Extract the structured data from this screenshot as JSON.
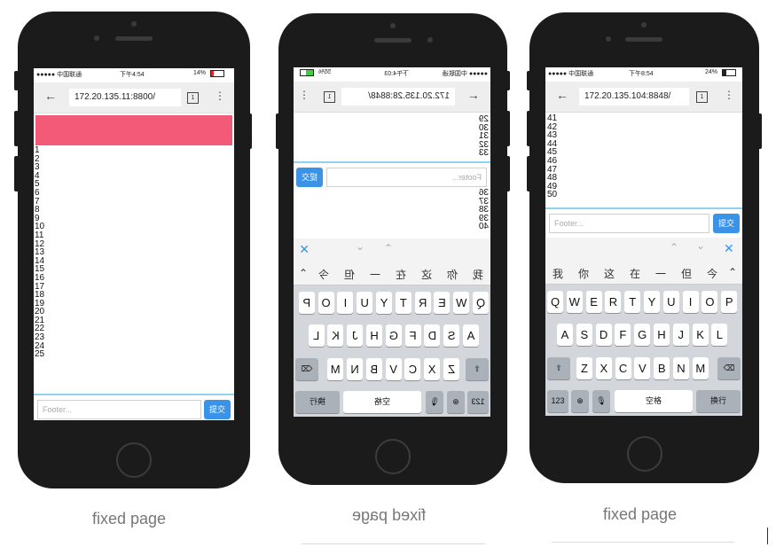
{
  "phones": [
    {
      "status": {
        "carrier": "●●●●● 中国联通",
        "time": "下午4:54",
        "battery": "14%"
      },
      "url": "172.20.135.11:8800/",
      "tab_count": "1",
      "numbers": [
        "1",
        "2",
        "3",
        "4",
        "5",
        "6",
        "7",
        "8",
        "9",
        "10",
        "11",
        "12",
        "13",
        "14",
        "15",
        "16",
        "17",
        "18",
        "19",
        "20",
        "21",
        "22",
        "23",
        "24",
        "25"
      ],
      "footer_placeholder": "Footer...",
      "send_label": "提交",
      "header_color": "#f25a78",
      "caption": "fixed page"
    },
    {
      "status": {
        "carrier": "●●●●● 中国联通",
        "time": "下午4:03",
        "battery": "55%"
      },
      "url": "172.20.135.28:8848/",
      "tab_count": "1",
      "numbers_top": [
        "29",
        "30",
        "31",
        "32",
        "33"
      ],
      "numbers_bottom": [
        "36",
        "37",
        "38",
        "39",
        "40"
      ],
      "footer_placeholder": "Footer...",
      "send_label": "提交",
      "candidates": [
        "我",
        "你",
        "这",
        "在",
        "一",
        "但",
        "今"
      ],
      "caption": "fixed page"
    },
    {
      "status": {
        "carrier": "●●●●● 中国联通",
        "time": "下午8:54",
        "battery": "24%"
      },
      "url": "172.20.135.104:8848/",
      "tab_count": "1",
      "numbers": [
        "41",
        "42",
        "43",
        "44",
        "45",
        "46",
        "47",
        "48",
        "49",
        "50"
      ],
      "footer_placeholder": "Footer...",
      "send_label": "提交",
      "candidates": [
        "我",
        "你",
        "这",
        "在",
        "一",
        "但",
        "今"
      ],
      "caption": "fixed page"
    }
  ],
  "keyboard": {
    "row1": [
      "Q",
      "W",
      "E",
      "R",
      "T",
      "Y",
      "U",
      "I",
      "O",
      "P"
    ],
    "row2": [
      "A",
      "S",
      "D",
      "F",
      "G",
      "H",
      "J",
      "K",
      "L"
    ],
    "row3": [
      "Z",
      "X",
      "C",
      "V",
      "B",
      "N",
      "M"
    ],
    "num_label": "123",
    "space_label": "空格",
    "return_label": "换行"
  }
}
